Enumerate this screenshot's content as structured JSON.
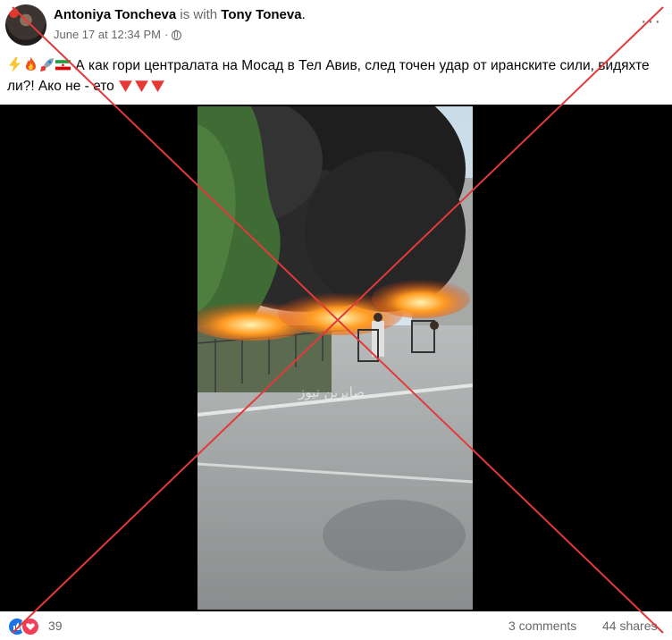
{
  "post": {
    "author_name": "Antoniya Toncheva",
    "with_text": "is with",
    "tagged_name": "Tony Toneva",
    "period": ".",
    "timestamp": "June 17 at 12:34 PM",
    "separator": "·",
    "privacy_icon": "globe-icon",
    "more_icon": "more-options-icon",
    "more_label": "···",
    "text_emojis": [
      "high-voltage-emoji",
      "fire-emoji",
      "rocket-emoji",
      "iran-flag-emoji"
    ],
    "text": "А как гори централата на Мосад в Тел Авив, след точен удар от иранските сили, видяхте ли?! Ако не - ето",
    "text_trailing_emojis": [
      "red-down-triangle-emoji",
      "red-down-triangle-emoji",
      "red-down-triangle-emoji"
    ]
  },
  "video": {
    "watermark": "صابرين نيوز",
    "content": "burning-street-scene"
  },
  "reactions": {
    "icons": [
      "like-icon",
      "love-icon"
    ],
    "count": "39",
    "comments": "3 comments",
    "shares": "44 shares"
  },
  "overlay": {
    "type": "red-cross",
    "color": "#e23a3a"
  },
  "colors": {
    "text": "#050505",
    "muted": "#65676b",
    "like_blue": "#1b74e4",
    "love_red": "#f33e58"
  }
}
